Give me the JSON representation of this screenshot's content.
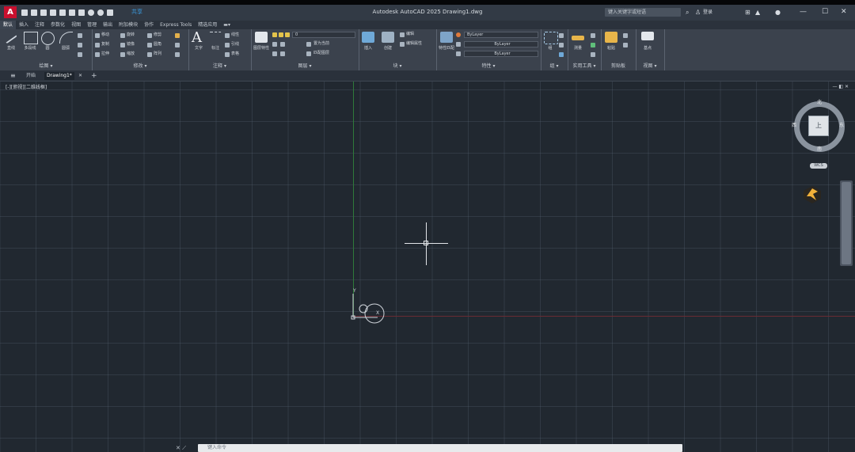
{
  "app": {
    "logo_letter": "A",
    "window_title": "Autodesk AutoCAD 2025 Drawing1.dwg",
    "share_label": "共享",
    "search_placeholder": "键入关键字或短语",
    "signin_label": "登录",
    "window_controls": [
      "—",
      "☐",
      "✕"
    ]
  },
  "ribbon_tabs": [
    {
      "label": "默认",
      "active": true
    },
    {
      "label": "插入"
    },
    {
      "label": "注释"
    },
    {
      "label": "参数化"
    },
    {
      "label": "视图"
    },
    {
      "label": "管理"
    },
    {
      "label": "输出"
    },
    {
      "label": "附加模块"
    },
    {
      "label": "协作"
    },
    {
      "label": "Express Tools"
    },
    {
      "label": "精选应用"
    },
    {
      "label": "▬▾"
    }
  ],
  "ribbon": {
    "draw": {
      "title": "绘图 ▾",
      "buttons": [
        "直线",
        "多段线",
        "圆",
        "圆弧"
      ]
    },
    "modify": {
      "title": "修改 ▾",
      "items": [
        "移动",
        "旋转",
        "修剪",
        "复制",
        "镜像",
        "圆角",
        "拉伸",
        "缩放",
        "阵列"
      ]
    },
    "annotation": {
      "title": "注释 ▾",
      "buttons": [
        "文字",
        "标注"
      ],
      "items": [
        "线性",
        "引线",
        "表格"
      ]
    },
    "layers": {
      "title": "图层 ▾",
      "buttons": [
        "图层特性"
      ],
      "current_layer": "0",
      "items": [
        "置为当前",
        "匹配图层"
      ]
    },
    "block": {
      "title": "块 ▾",
      "buttons": [
        "插入",
        "创建",
        "编辑"
      ],
      "items": [
        "编辑属性"
      ]
    },
    "properties": {
      "title": "特性 ▾",
      "buttons": [
        "特性匹配"
      ],
      "color_value": "ByLayer",
      "linetype_value": "ByLayer",
      "lineweight_value": "ByLayer"
    },
    "groups": {
      "title": "组 ▾",
      "buttons": [
        "组"
      ]
    },
    "utilities": {
      "title": "实用工具 ▾",
      "buttons": [
        "测量"
      ]
    },
    "clipboard": {
      "title": "剪贴板",
      "buttons": [
        "粘贴"
      ]
    },
    "view": {
      "title": "视图 ▾",
      "buttons": [
        "基点"
      ]
    }
  },
  "doc_tabs": [
    {
      "label": "开始"
    },
    {
      "label": "Drawing1*",
      "active": true,
      "close": "✕"
    },
    {
      "label": "+"
    }
  ],
  "viewport": {
    "label": "[-][俯视][二维线框]",
    "controls": "— ◧ ✕",
    "ucs_y": "Y",
    "ucs_x": "X"
  },
  "viewcube": {
    "face": "上",
    "north": "北",
    "south": "南",
    "east": "东",
    "west": "西",
    "wcs": "WCS"
  },
  "command": {
    "icons": "✕ ⟋",
    "placeholder": "键入命令"
  },
  "colors": {
    "background": "#212830",
    "ribbon": "#3b424d",
    "y_axis": "#2f7a3a",
    "x_axis": "#6a2b33",
    "crosshair": "#e2e5e9",
    "accent": "#c8102e"
  }
}
